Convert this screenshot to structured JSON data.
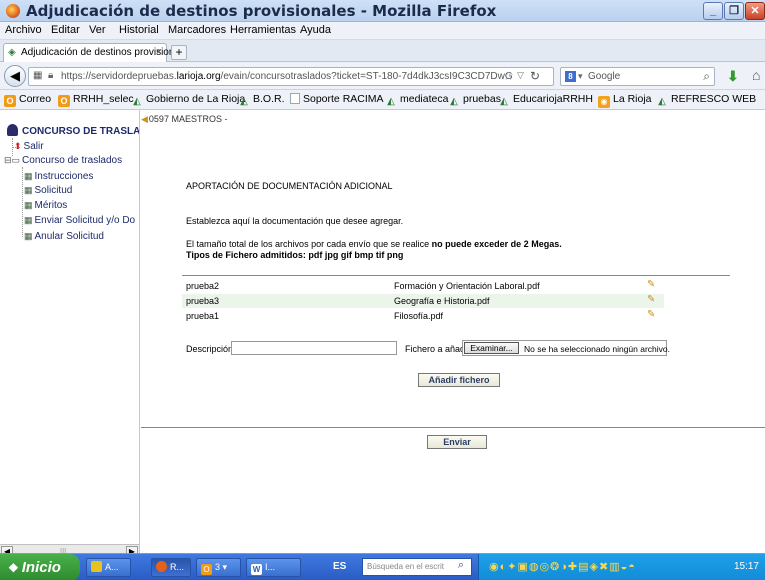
{
  "window": {
    "title": "Adjudicación de destinos provisionales - Mozilla Firefox",
    "minimize_label": "_",
    "maximize_label": "❐",
    "close_label": "✕"
  },
  "menu": [
    "Archivo",
    "Editar",
    "Ver",
    "Historial",
    "Marcadores",
    "Herramientas",
    "Ayuda"
  ],
  "tab": {
    "title": "Adjudicación de destinos provision...",
    "close": "×",
    "new": "+"
  },
  "navbar": {
    "url_prefix": "https://servidordepruebas.",
    "url_domain": "larioja.org",
    "url_suffix": "/evain/concursotraslados?ticket=ST-180-7d4dkJ3csI9C3CD7DwG",
    "search_placeholder": "Google",
    "search_engine": "8"
  },
  "bookmarks": [
    {
      "label": "Correo",
      "icon": "orange-o-icon"
    },
    {
      "label": "RRHH_selec",
      "icon": "orange-o-icon"
    },
    {
      "label": "Gobierno de La Rioja",
      "icon": "green-folder-icon"
    },
    {
      "label": "B.O.R.",
      "icon": "green-folder-icon"
    },
    {
      "label": "Soporte RACIMA",
      "icon": "page-icon"
    },
    {
      "label": "mediateca",
      "icon": "green-folder-icon"
    },
    {
      "label": "pruebas",
      "icon": "green-folder-icon"
    },
    {
      "label": "EducariojaRRHH",
      "icon": "green-folder-icon"
    },
    {
      "label": "La Rioja",
      "icon": "rss-icon"
    },
    {
      "label": "REFRESCO WEB",
      "icon": "green-folder-icon"
    }
  ],
  "tree": {
    "root": "CONCURSO DE TRASLAD",
    "salir": "Salir",
    "folder": "Concurso de traslados",
    "items": [
      "Instrucciones",
      "Solicitud",
      "Méritos",
      "Enviar Solicitud y/o Do",
      "Anular Solicitud"
    ]
  },
  "main": {
    "breadcrumb": "0597 MAESTROS -",
    "section_title": "APORTACIÓN DE DOCUMENTACIÓN ADICIONAL",
    "instructions": "Establezca aquí la documentación que desee agregar.",
    "limit_text": "El tamaño total de los archivos por cada envío que se realice ",
    "limit_bold": "no puede exceder de 2 Megas.",
    "types": "Tipos de Fichero admitidos: pdf jpg gif bmp tif png",
    "files": [
      {
        "name": "prueba2",
        "desc": "Formación y Orientación Laboral.pdf"
      },
      {
        "name": "prueba3",
        "desc": "Geografía e Historia.pdf"
      },
      {
        "name": "prueba1",
        "desc": "Filosofía.pdf"
      }
    ],
    "description_label": "Descripción",
    "description_value": "",
    "file_label": "Fichero a añadir",
    "browse_label": "Examinar...",
    "no_file": "No se ha seleccionado ningún archivo.",
    "add_button": "Añadir fichero",
    "send_button": "Enviar"
  },
  "taskbar": {
    "start": "Inicio",
    "tasks": [
      {
        "label": "A...",
        "icon": "chrome-icon"
      },
      {
        "label": "R...",
        "icon": "firefox-icon"
      },
      {
        "label": "3",
        "icon": "outlook-icon"
      },
      {
        "label": "I...",
        "icon": "word-icon"
      }
    ],
    "lang": "ES",
    "search_placeholder": "Búsqueda en el escrit",
    "clock": "15:17"
  },
  "colors": {
    "accent": "#2a5cc4",
    "tree_text": "#1d2a6a",
    "alt_row": "#ecf5ea"
  }
}
